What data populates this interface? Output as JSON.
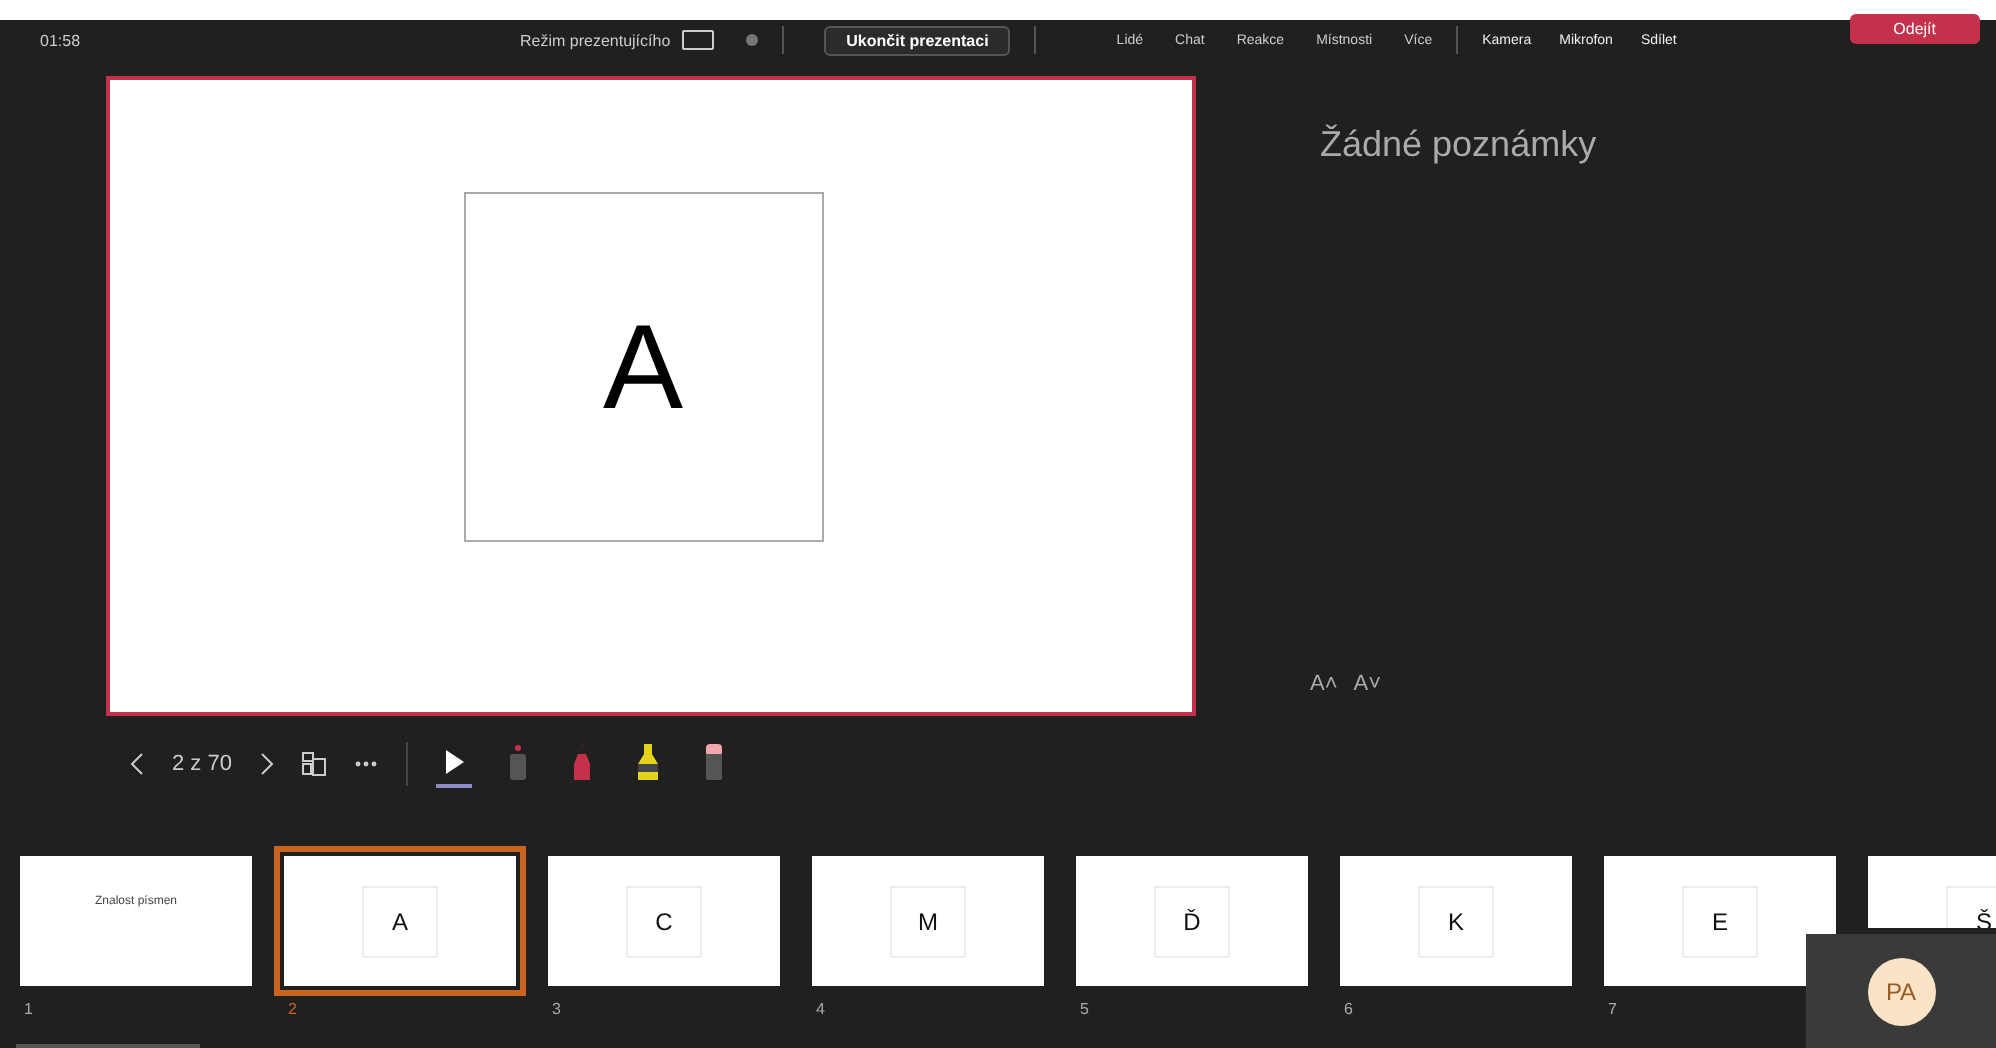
{
  "top_bar": {
    "time": "01:58",
    "mode_label": "Režim prezentujícího",
    "stop_button": "Ukončit prezentaci",
    "nav_items": [
      {
        "label": "Lidé"
      },
      {
        "label": "Chat"
      },
      {
        "label": "Reakce"
      },
      {
        "label": "Místnosti"
      },
      {
        "label": "Více"
      }
    ],
    "device_items": [
      {
        "label": "Kamera"
      },
      {
        "label": "Mikrofon"
      },
      {
        "label": "Sdílet"
      }
    ],
    "leave_button": "Odejít"
  },
  "stage": {
    "slide_letter": "A",
    "page_indicator": "2 z 70",
    "tools": [
      {
        "kind": "pointer",
        "selected": true
      },
      {
        "kind": "laser",
        "selected": false
      },
      {
        "kind": "pen",
        "selected": false
      },
      {
        "kind": "highlighter",
        "selected": false
      },
      {
        "kind": "eraser",
        "selected": false
      }
    ]
  },
  "notes": {
    "text": "Žádné poznámky",
    "font_up": "A˄",
    "font_down": "A˅"
  },
  "slides": [
    {
      "kind": "title",
      "text": "Znalost písmen",
      "number": "1",
      "selected": false
    },
    {
      "kind": "letter",
      "text": "A",
      "number": "2",
      "selected": true
    },
    {
      "kind": "letter",
      "text": "C",
      "number": "3",
      "selected": false
    },
    {
      "kind": "letter",
      "text": "M",
      "number": "4",
      "selected": false
    },
    {
      "kind": "letter",
      "text": "Ď",
      "number": "5",
      "selected": false
    },
    {
      "kind": "letter",
      "text": "K",
      "number": "6",
      "selected": false
    },
    {
      "kind": "letter",
      "text": "E",
      "number": "7",
      "selected": false
    },
    {
      "kind": "letter",
      "text": "Š",
      "selected": false
    }
  ],
  "self_view": {
    "initials": "PA"
  }
}
